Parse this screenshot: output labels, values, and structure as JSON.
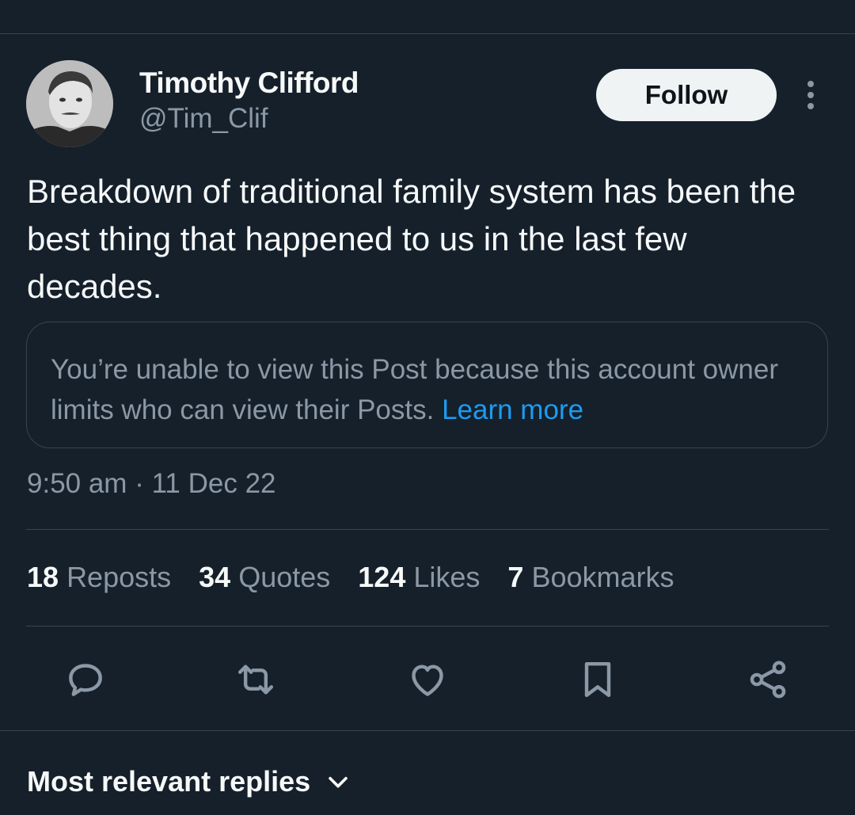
{
  "author": {
    "display_name": "Timothy Clifford",
    "handle": "@Tim_Clif"
  },
  "follow_label": "Follow",
  "tweet_text": "Breakdown of traditional family system has been the best thing that happened to us in the last few decades.",
  "notice": {
    "text": "You’re unable to view this Post because this account owner limits who can view their Posts.",
    "link": "Learn more"
  },
  "timestamp": "9:50 am · 11 Dec 22",
  "stats": [
    {
      "count": "18",
      "label": "Reposts"
    },
    {
      "count": "34",
      "label": "Quotes"
    },
    {
      "count": "124",
      "label": "Likes"
    },
    {
      "count": "7",
      "label": "Bookmarks"
    }
  ],
  "actions": [
    "reply-icon",
    "repost-icon",
    "like-icon",
    "bookmark-icon",
    "share-icon"
  ],
  "replies_sort_label": "Most relevant replies",
  "colors": {
    "background": "#15202b",
    "text": "#f7f9f9",
    "secondary": "#8b98a5",
    "accent": "#1d9bf0",
    "border": "#38444d"
  }
}
